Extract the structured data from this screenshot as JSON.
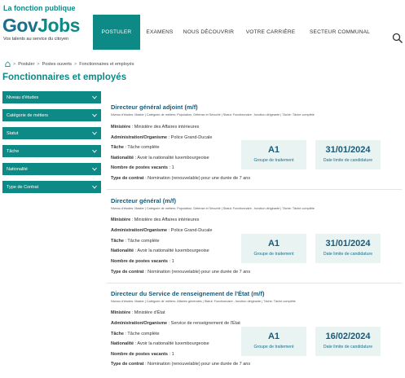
{
  "header": {
    "brand_top": "La fonction publique",
    "brand_gov": "Gov",
    "brand_jobs": "Jobs",
    "brand_sub": "Vos talents au service du citoyen",
    "nav": [
      "POSTULER",
      "EXAMENS",
      "NOUS DÉCOUVRIR",
      "VOTRE CARRIÈRE",
      "SECTEUR COMMUNAL"
    ],
    "search_icon": "search-icon"
  },
  "breadcrumb": {
    "items": [
      "Postuler",
      "Postes ouverts",
      "Fonctionnaires et employés"
    ]
  },
  "page_title": "Fonctionnaires et employés",
  "filters": [
    "Niveau d'études",
    "Catégorie de métiers",
    "Statut",
    "Tâche",
    "Nationalité",
    "Type de Contrat"
  ],
  "labels": {
    "ministere": "Ministère",
    "administration": "Administration/Organisme",
    "tache": "Tâche",
    "nationalite": "Nationalité",
    "postes": "Nombre de postes vacants",
    "contrat": "Type de contrat",
    "groupe": "Groupe de traitement",
    "date_limite": "Date limite de candidature"
  },
  "offers": [
    {
      "title": "Directeur général adjoint (m/f)",
      "meta": "Niveau d'études: Master | Catégorie de métiers: Population, Défense et Sécurité | Statut: Fonctionnaire - fonction dirigeante | Tâche: Tâche complète",
      "ministere": "Ministère des Affaires intérieures",
      "administration": "Police Grand-Ducale",
      "tache": "Tâche complète",
      "nationalite": "Avoir la nationalité luxembourgeoise",
      "postes": "1",
      "contrat": "Nomination (renouvelable) pour une durée de 7 ans",
      "groupe": "A1",
      "date": "31/01/2024"
    },
    {
      "title": "Directeur général (m/f)",
      "meta": "Niveau d'études: Master | Catégorie de métiers: Population, Défense et Sécurité | Statut: Fonctionnaire - fonction dirigeante | Tâche: Tâche complète",
      "ministere": "Ministère des Affaires intérieures",
      "administration": "Police Grand-Ducale",
      "tache": "Tâche complète",
      "nationalite": "Avoir la nationalité luxembourgeoise",
      "postes": "1",
      "contrat": "Nomination (renouvelable) pour une durée de 7 ans",
      "groupe": "A1",
      "date": "31/01/2024"
    },
    {
      "title": "Directeur du Service de renseignement de l'État (m/f)",
      "meta": "Niveau d'études: Master | Catégorie de métiers: Affaires générales | Statut: Fonctionnaire - fonction dirigeante | Tâche: Tâche complète",
      "ministere": "Ministère d'État",
      "administration": "Service de renseignement de l'État",
      "tache": "Tâche complète",
      "nationalite": "Avoir la nationalité luxembourgeoise",
      "postes": "1",
      "contrat": "Nomination (renouvelable) pour une durée de 7 ans",
      "groupe": "A1",
      "date": "16/02/2024"
    }
  ],
  "colors": {
    "primary": "#0e8a86",
    "heading": "#1a5a78",
    "box_bg": "#e8f3f2"
  }
}
